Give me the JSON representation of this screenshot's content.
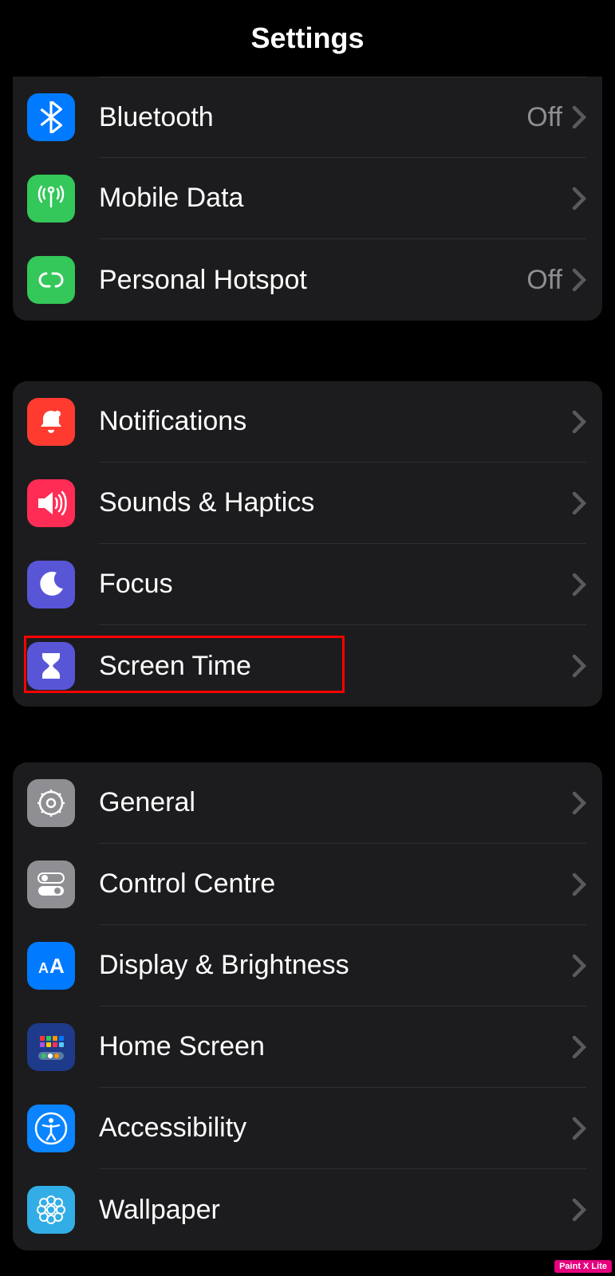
{
  "header": {
    "title": "Settings"
  },
  "groups": [
    {
      "items": [
        {
          "label": "Bluetooth",
          "value": "Off",
          "icon": "bluetooth-icon",
          "color": "icon-blue"
        },
        {
          "label": "Mobile Data",
          "value": "",
          "icon": "antenna-icon",
          "color": "icon-green"
        },
        {
          "label": "Personal Hotspot",
          "value": "Off",
          "icon": "hotspot-icon",
          "color": "icon-green"
        }
      ]
    },
    {
      "items": [
        {
          "label": "Notifications",
          "value": "",
          "icon": "bell-icon",
          "color": "icon-red"
        },
        {
          "label": "Sounds & Haptics",
          "value": "",
          "icon": "speaker-icon",
          "color": "icon-pink"
        },
        {
          "label": "Focus",
          "value": "",
          "icon": "moon-icon",
          "color": "icon-indigo"
        },
        {
          "label": "Screen Time",
          "value": "",
          "icon": "hourglass-icon",
          "color": "icon-indigo"
        }
      ]
    },
    {
      "items": [
        {
          "label": "General",
          "value": "",
          "icon": "gear-icon",
          "color": "icon-gray"
        },
        {
          "label": "Control Centre",
          "value": "",
          "icon": "toggles-icon",
          "color": "icon-gray"
        },
        {
          "label": "Display & Brightness",
          "value": "",
          "icon": "text-size-icon",
          "color": "icon-blue"
        },
        {
          "label": "Home Screen",
          "value": "",
          "icon": "grid-icon",
          "color": "icon-navy"
        },
        {
          "label": "Accessibility",
          "value": "",
          "icon": "accessibility-icon",
          "color": "icon-blue2"
        },
        {
          "label": "Wallpaper",
          "value": "",
          "icon": "flower-icon",
          "color": "icon-cyan"
        }
      ]
    }
  ],
  "watermark": "Paint X Lite"
}
